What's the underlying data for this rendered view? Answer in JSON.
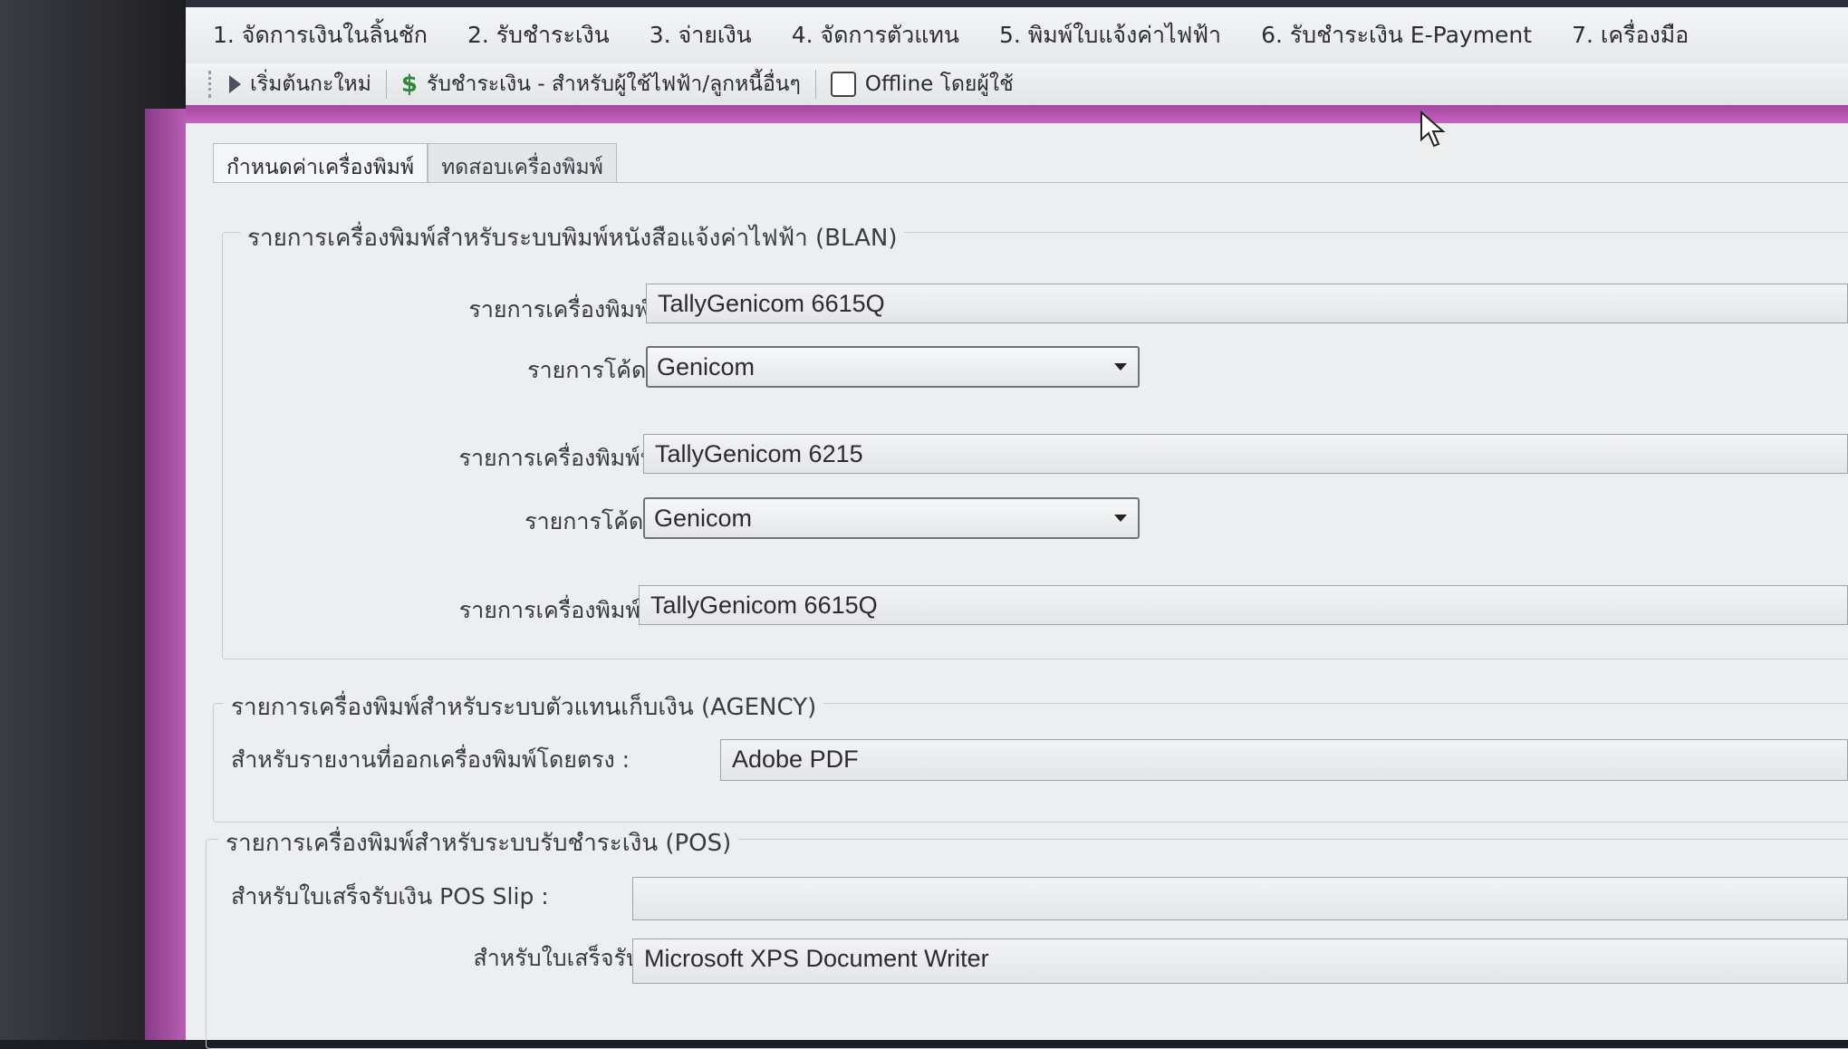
{
  "menu": [
    "1. จัดการเงินในลิ้นชัก",
    "2. รับชำระเงิน",
    "3. จ่ายเงิน",
    "4. จัดการตัวแทน",
    "5. พิมพ์ใบแจ้งค่าไฟฟ้า",
    "6. รับชำระเงิน E-Payment",
    "7. เครื่องมือ"
  ],
  "toolbar": {
    "restart_label": "เริ่มต้นกะใหม่",
    "payment_label": "รับชำระเงิน - สำหรับผู้ใช้ไฟฟ้า/ลูกหนี้อื่นๆ",
    "offline_label": "Offline โดยผู้ใช้",
    "offline_checked": false
  },
  "tabs": {
    "settings": "กำหนดค่าเครื่องพิมพ์",
    "test": "ทดสอบเครื่องพิมพ์"
  },
  "blan": {
    "title": "รายการเครื่องพิมพ์สำหรับระบบพิมพ์หนังสือแจ้งค่าไฟฟ้า (BLAN)",
    "agent_bill_label": "รายการเครื่องพิมพ์บิลตัวแทน :",
    "agent_bill_value": "TallyGenicom 6615Q",
    "code1_label": "รายการโค้ดเครื่องพิมพ์ :",
    "code1_value": "Genicom",
    "notice_label": "รายการเครื่องพิมพ์หนังสือแจ้ง :",
    "notice_value": "TallyGenicom 6215",
    "code2_label": "รายการโค้ดเครื่องพิมพ์ :",
    "code2_value": "Genicom",
    "bank_bill_label": "รายการเครื่องพิมพ์บิลธนาคาร :",
    "bank_bill_value": "TallyGenicom 6615Q"
  },
  "agency": {
    "title": "รายการเครื่องพิมพ์สำหรับระบบตัวแทนเก็บเงิน (AGENCY)",
    "direct_label": "สำหรับรายงานที่ออกเครื่องพิมพ์โดยตรง :",
    "direct_value": "Adobe PDF"
  },
  "pos": {
    "title": "รายการเครื่องพิมพ์สำหรับระบบรับชำระเงิน (POS)",
    "slip_label": "สำหรับใบเสร็จรับเงิน POS Slip :",
    "slip_value": "",
    "general_label": "สำหรับใบเสร็จรับเงินทั่วไป :",
    "general_value": "Microsoft XPS Document Writer"
  },
  "colors": {
    "accent_magenta": "#b65db4",
    "background": "#eceef0"
  }
}
